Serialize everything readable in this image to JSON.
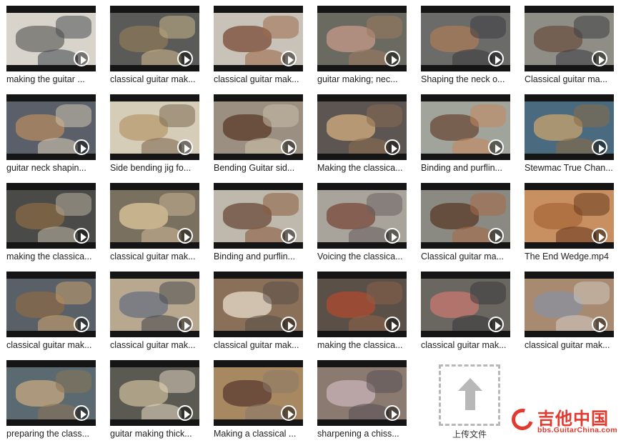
{
  "videos": [
    {
      "caption": "making the guitar ...",
      "colors": [
        "#6b6b65",
        "#d8d4cc",
        "#4a4e52"
      ]
    },
    {
      "caption": "classical guitar mak...",
      "colors": [
        "#8c7a5a",
        "#5a5a58",
        "#c9b48a"
      ]
    },
    {
      "caption": "classical guitar mak...",
      "colors": [
        "#7a4a35",
        "#c8c2b8",
        "#9e6b4d"
      ]
    },
    {
      "caption": "guitar making; nec...",
      "colors": [
        "#c79a8a",
        "#6a6a60",
        "#9b7a60"
      ]
    },
    {
      "caption": "Shaping the neck o...",
      "colors": [
        "#a87b58",
        "#6b6b6a",
        "#3c3c40"
      ]
    },
    {
      "caption": "Classical guitar ma...",
      "colors": [
        "#6a5040",
        "#8e8e86",
        "#3e3f44"
      ]
    },
    {
      "caption": "guitar neck shapin...",
      "colors": [
        "#b48a62",
        "#5a5f6a",
        "#d0c4b0"
      ]
    },
    {
      "caption": "Side bending jig fo...",
      "colors": [
        "#b79a70",
        "#d6cdb8",
        "#7e6a52"
      ]
    },
    {
      "caption": "Bending Guitar sid...",
      "colors": [
        "#5a3a2a",
        "#9a8f80",
        "#c9bfa8"
      ]
    },
    {
      "caption": "Making the classica...",
      "colors": [
        "#d4b080",
        "#5c5552",
        "#8a6c50"
      ]
    },
    {
      "caption": "Binding and purflin...",
      "colors": [
        "#6a4a35",
        "#a0a49a",
        "#c58860"
      ]
    },
    {
      "caption": "Stewmac True Chan...",
      "colors": [
        "#c9a46e",
        "#4a6a80",
        "#8b6a45"
      ]
    },
    {
      "caption": "making the classica...",
      "colors": [
        "#8a6a45",
        "#4a4a48",
        "#b8b0a0"
      ]
    },
    {
      "caption": "classical guitar mak...",
      "colors": [
        "#e0c89c",
        "#7a7060",
        "#c9b494"
      ]
    },
    {
      "caption": "Binding and purflin...",
      "colors": [
        "#6a4a38",
        "#bfb8ac",
        "#8a5c40"
      ]
    },
    {
      "caption": "Voicing the classica...",
      "colors": [
        "#7a4a3a",
        "#a8a49c",
        "#6a6060"
      ]
    },
    {
      "caption": "Classical guitar ma...",
      "colors": [
        "#5a3a28",
        "#8a8a82",
        "#a86a48"
      ]
    },
    {
      "caption": "The End Wedge.mp4",
      "colors": [
        "#a86838",
        "#c89060",
        "#6a3a20"
      ]
    },
    {
      "caption": "classical guitar mak...",
      "colors": [
        "#8a6a4a",
        "#5a6068",
        "#c8a070"
      ]
    },
    {
      "caption": "classical guitar mak...",
      "colors": [
        "#6a7080",
        "#b8a890",
        "#4a4a4e"
      ]
    },
    {
      "caption": "classical guitar mak...",
      "colors": [
        "#e8dccc",
        "#8a7058",
        "#5a5048"
      ]
    },
    {
      "caption": "making the classica...",
      "colors": [
        "#b04a30",
        "#5a5048",
        "#8a6048"
      ]
    },
    {
      "caption": "classical guitar mak...",
      "colors": [
        "#c87a70",
        "#6a6660",
        "#3a3a3e"
      ]
    },
    {
      "caption": "classical guitar mak...",
      "colors": [
        "#8a90a0",
        "#a88a70",
        "#d0c8c0"
      ]
    },
    {
      "caption": "preparing the class...",
      "colors": [
        "#c8a880",
        "#5a6a70",
        "#8a7458"
      ]
    },
    {
      "caption": "guitar making thick...",
      "colors": [
        "#c8b898",
        "#5a5a52",
        "#e0d4c0"
      ]
    },
    {
      "caption": "Making a classical ...",
      "colors": [
        "#5a3a30",
        "#a88860",
        "#8a7a6a"
      ]
    },
    {
      "caption": "sharpening a chiss...",
      "colors": [
        "#c8b4b8",
        "#8a7a70",
        "#5a5058"
      ]
    }
  ],
  "upload": {
    "label": "上传文件"
  },
  "logo": {
    "text": "吉他中国",
    "site": "bbs.GuitarChina.com"
  }
}
